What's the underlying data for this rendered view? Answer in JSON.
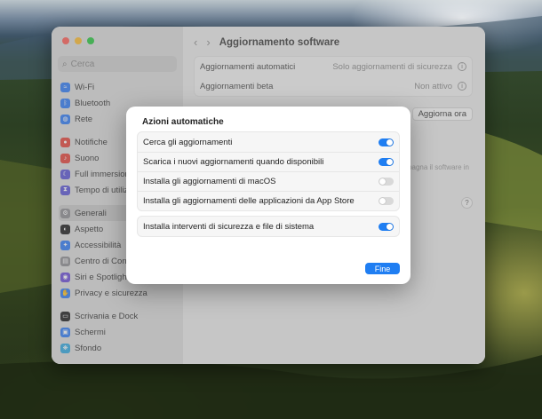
{
  "window": {
    "title": "Aggiornamento software"
  },
  "sidebar": {
    "search_placeholder": "Cerca",
    "groups": [
      [
        {
          "label": "Wi-Fi",
          "icon": "wifi-icon",
          "color": "#2f7cf6"
        },
        {
          "label": "Bluetooth",
          "icon": "bluetooth-icon",
          "color": "#2f7cf6"
        },
        {
          "label": "Rete",
          "icon": "globe-icon",
          "color": "#2f7cf6"
        }
      ],
      [
        {
          "label": "Notifiche",
          "icon": "bell-icon",
          "color": "#e5443b"
        },
        {
          "label": "Suono",
          "icon": "speaker-icon",
          "color": "#e5443b"
        },
        {
          "label": "Full immersion",
          "icon": "moon-icon",
          "color": "#5b55d6"
        },
        {
          "label": "Tempo di utilizzo",
          "icon": "hourglass-icon",
          "color": "#5b55d6"
        }
      ],
      [
        {
          "label": "Generali",
          "icon": "gear-icon",
          "color": "#8e8e93"
        },
        {
          "label": "Aspetto",
          "icon": "appearance-icon",
          "color": "#1c1c1e"
        },
        {
          "label": "Accessibilità",
          "icon": "accessibility-icon",
          "color": "#2f7cf6"
        },
        {
          "label": "Centro di Controllo",
          "icon": "control-center-icon",
          "color": "#8e8e93"
        },
        {
          "label": "Siri e Spotlight",
          "icon": "siri-icon",
          "color": "#6a4cd8"
        },
        {
          "label": "Privacy e sicurezza",
          "icon": "hand-icon",
          "color": "#2f7cf6"
        }
      ],
      [
        {
          "label": "Scrivania e Dock",
          "icon": "dock-icon",
          "color": "#1c1c1e"
        },
        {
          "label": "Schermi",
          "icon": "display-icon",
          "color": "#2f7cf6"
        },
        {
          "label": "Sfondo",
          "icon": "wallpaper-icon",
          "color": "#2fa8e0"
        }
      ]
    ],
    "selected": "Generali"
  },
  "main": {
    "rows": [
      {
        "label": "Aggiornamenti automatici",
        "value": "Solo aggiornamenti di sicurezza"
      },
      {
        "label": "Aggiornamenti beta",
        "value": "Non attivo"
      }
    ],
    "update_button": "Aggiorna ora",
    "bg_note": "pagna il software in",
    "help": "?"
  },
  "sheet": {
    "title": "Azioni automatiche",
    "options": [
      {
        "label": "Cerca gli aggiornamenti",
        "on": true
      },
      {
        "label": "Scarica i nuovi aggiornamenti quando disponibili",
        "on": true
      },
      {
        "label": "Installa gli aggiornamenti di macOS",
        "on": false
      },
      {
        "label": "Installa gli aggiornamenti delle applicazioni da App Store",
        "on": false
      }
    ],
    "security_option": {
      "label": "Installa interventi di sicurezza e file di sistema",
      "on": true
    },
    "done_button": "Fine"
  },
  "colors": {
    "accent": "#1f7ef2",
    "toggle_off": "#d9d9d9"
  }
}
